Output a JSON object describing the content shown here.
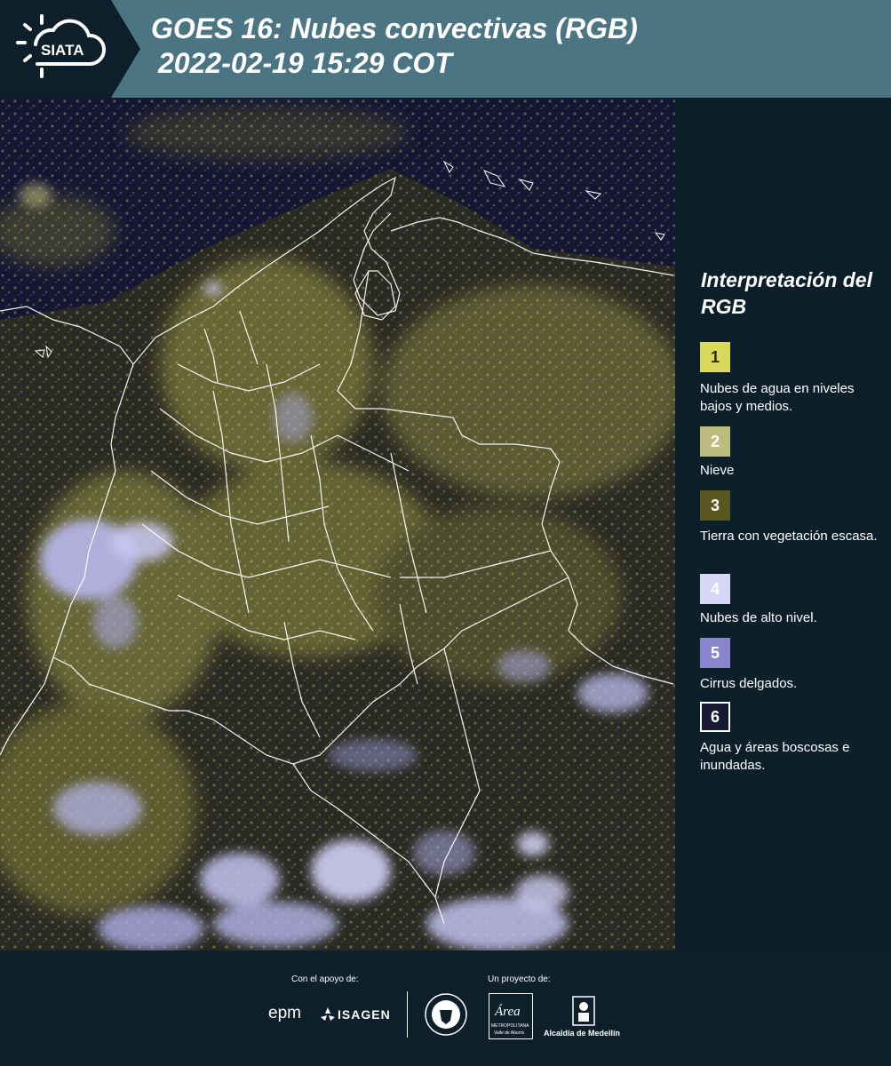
{
  "header": {
    "logo_text": "SIATA",
    "title_line1": "GOES 16: Nubes convectivas (RGB)",
    "title_line2": "2022-02-19 15:29 COT"
  },
  "map": {
    "icon": "satellite-map-image",
    "colors": {
      "background": "#151634",
      "land": "#3a3a24",
      "low_clouds": "#c9c76a",
      "high_clouds": "#b9b8f0",
      "borders": "#ffffff"
    }
  },
  "legend": {
    "title": "Interpretación del RGB",
    "items": [
      {
        "number": "1",
        "color": "#d8d85a",
        "text_color": "#2a2a10",
        "label": "Nubes de agua en niveles bajos y medios."
      },
      {
        "number": "2",
        "color": "#bdbb7d",
        "text_color": "#ffffff",
        "label": "Nieve"
      },
      {
        "number": "3",
        "color": "#5a5620",
        "text_color": "#ffffff",
        "label": "Tierra con vegetación escasa."
      },
      {
        "number": "4",
        "color": "#d6d6f6",
        "text_color": "#ffffff",
        "label": "Nubes de alto nivel."
      },
      {
        "number": "5",
        "color": "#8886cc",
        "text_color": "#ffffff",
        "label": "Cirrus delgados."
      },
      {
        "number": "6",
        "color": "#191933",
        "text_color": "#ffffff",
        "label": "Agua y áreas boscosas e inundadas."
      }
    ]
  },
  "footer": {
    "support_label": "Con el apoyo de:",
    "project_label": "Un proyecto de:",
    "epm_logo": "epm",
    "isagen_logo": "ISAGEN",
    "area_logo_text": "Área",
    "area_sub": "METROPOLITANA",
    "area_sub2": "Valle de Aburrá",
    "alcaldia_label": "Alcaldía de Medellín"
  }
}
